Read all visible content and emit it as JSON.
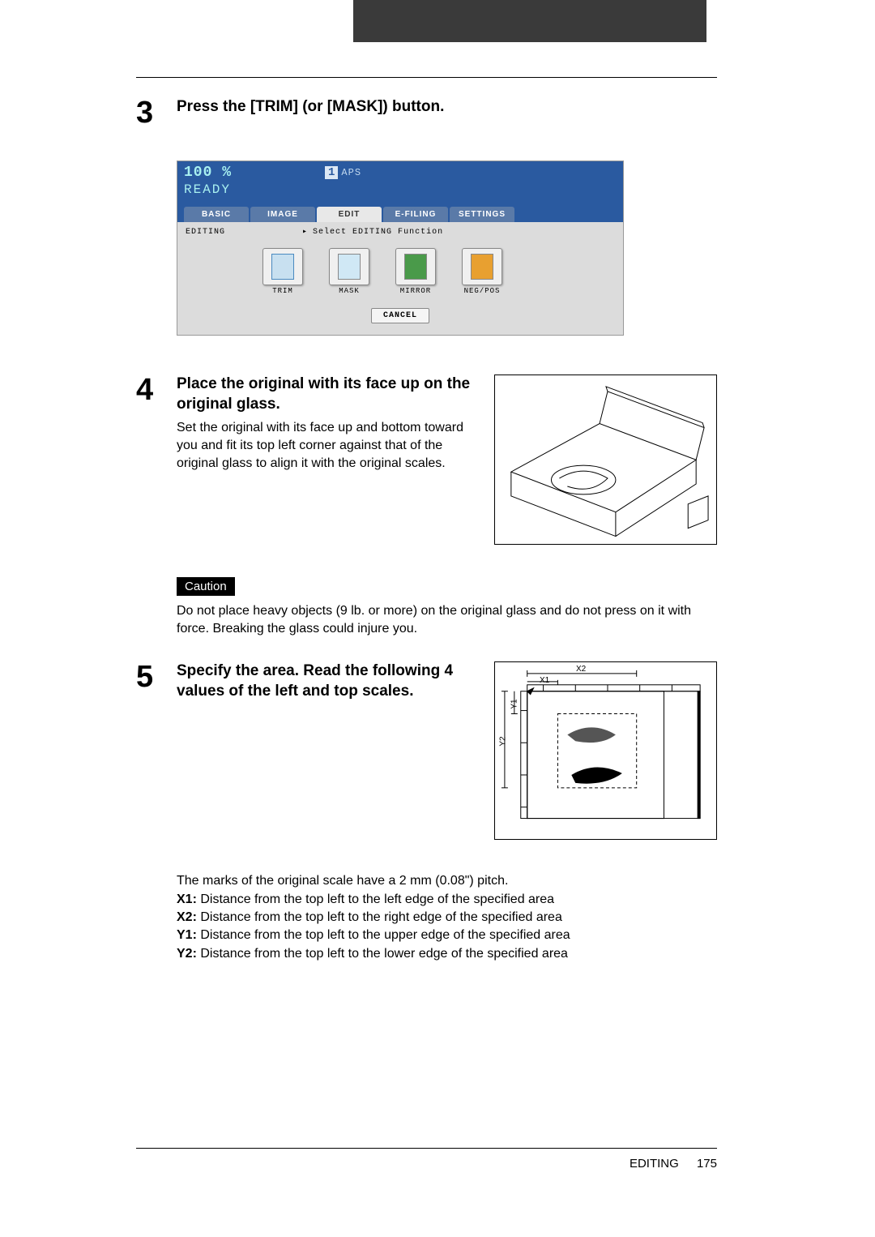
{
  "step3": {
    "heading": "Press the [TRIM] (or [MASK]) button.",
    "screen": {
      "percent": "100 %",
      "one": "1",
      "aps": "APS",
      "ready": "READY",
      "tabs": [
        "BASIC",
        "IMAGE",
        "EDIT",
        "E-FILING",
        "SETTINGS"
      ],
      "breadcrumb_left": "EDITING",
      "breadcrumb_right": "Select EDITING Function",
      "buttons": [
        "TRIM",
        "MASK",
        "MIRROR",
        "NEG/POS"
      ],
      "cancel": "CANCEL"
    }
  },
  "step4": {
    "heading": "Place the original with its face up on the original glass.",
    "body": "Set the original with its face up and bottom toward you and fit its top left corner against that of the original glass to align it with the original scales."
  },
  "caution": {
    "label": "Caution",
    "text": "Do not place heavy objects (9 lb. or more) on the original glass and do not press on it with force. Breaking the glass could injure you."
  },
  "step5": {
    "heading": "Specify the area. Read the following 4 values of the left and top scales.",
    "diagram": {
      "x1": "X1",
      "x2": "X2",
      "y1": "Y1",
      "y2": "Y2"
    },
    "intro": "The marks of the original scale have a 2 mm (0.08\") pitch.",
    "x1_l": "X1:",
    "x1_t": " Distance from the top left to the left edge of the specified area",
    "x2_l": "X2:",
    "x2_t": " Distance from the top left to the right edge of the specified area",
    "y1_l": "Y1:",
    "y1_t": " Distance from the top left to the upper edge of the specified area",
    "y2_l": "Y2:",
    "y2_t": " Distance from the top left to the lower edge of the specified area"
  },
  "footer": {
    "section": "EDITING",
    "page": "175"
  }
}
